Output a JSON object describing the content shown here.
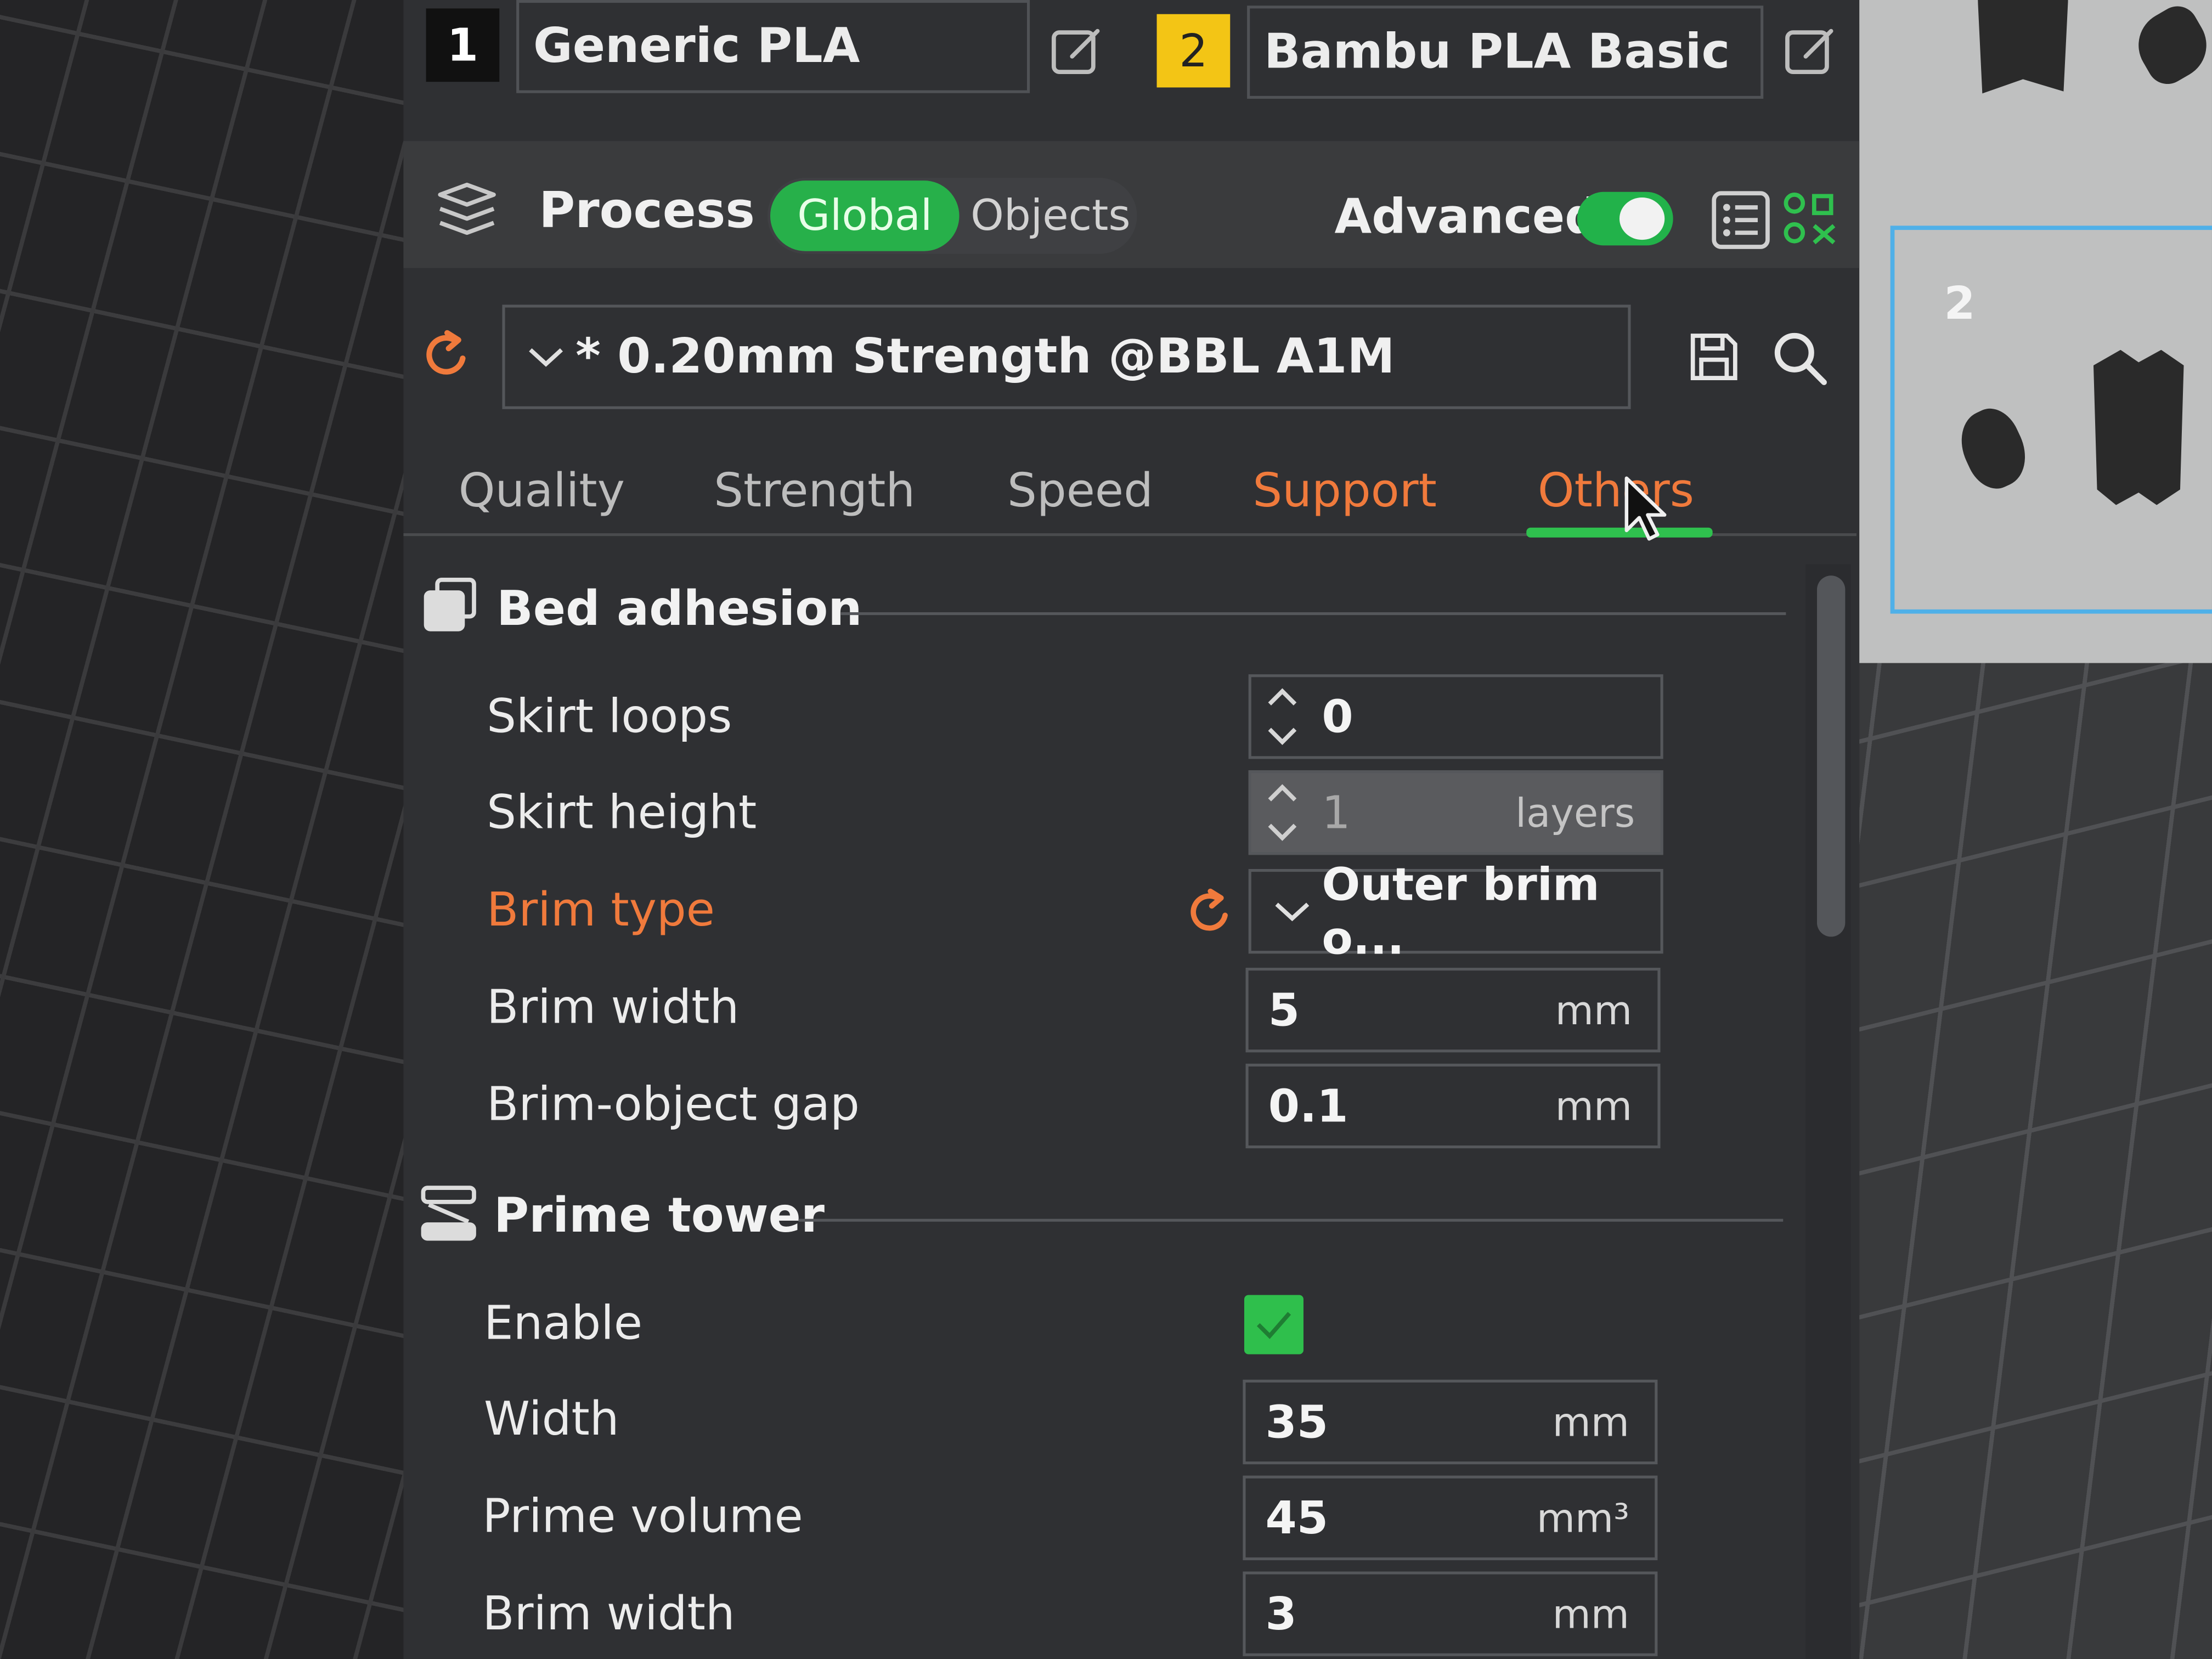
{
  "filaments": [
    {
      "number": "1",
      "name": "Generic PLA",
      "badge_color": "#111111"
    },
    {
      "number": "2",
      "name": "Bambu PLA Basic",
      "badge_color": "#f3c515"
    }
  ],
  "process": {
    "label": "Process",
    "scope_options": [
      "Global",
      "Objects"
    ],
    "selected_scope": "Global",
    "advanced_label": "Advanced",
    "advanced_enabled": true
  },
  "preset": {
    "name": "* 0.20mm Strength @BBL A1M"
  },
  "tabs": [
    {
      "label": "Quality",
      "modified": false,
      "active": false
    },
    {
      "label": "Strength",
      "modified": false,
      "active": false
    },
    {
      "label": "Speed",
      "modified": false,
      "active": false
    },
    {
      "label": "Support",
      "modified": true,
      "active": false
    },
    {
      "label": "Others",
      "modified": true,
      "active": true
    }
  ],
  "sections": {
    "bed_adhesion": {
      "title": "Bed adhesion",
      "rows": {
        "skirt_loops": {
          "label": "Skirt loops",
          "value": "0",
          "unit": ""
        },
        "skirt_height": {
          "label": "Skirt height",
          "value": "1",
          "unit": "layers"
        },
        "brim_type": {
          "label": "Brim type",
          "value": "Outer brim o...",
          "modified": true
        },
        "brim_width": {
          "label": "Brim width",
          "value": "5",
          "unit": "mm"
        },
        "brim_object_gap": {
          "label": "Brim-object gap",
          "value": "0.1",
          "unit": "mm"
        }
      }
    },
    "prime_tower": {
      "title": "Prime tower",
      "rows": {
        "enable": {
          "label": "Enable",
          "checked": true
        },
        "width": {
          "label": "Width",
          "value": "35",
          "unit": "mm"
        },
        "prime_volume": {
          "label": "Prime volume",
          "value": "45",
          "unit": "mm³"
        },
        "brim_width": {
          "label": "Brim width",
          "value": "3",
          "unit": "mm"
        }
      }
    }
  },
  "plate": {
    "number": "2"
  },
  "colors": {
    "accent_green": "#2fc04e",
    "modified_orange": "#f07a3c",
    "panel_bg": "#2f3033"
  }
}
